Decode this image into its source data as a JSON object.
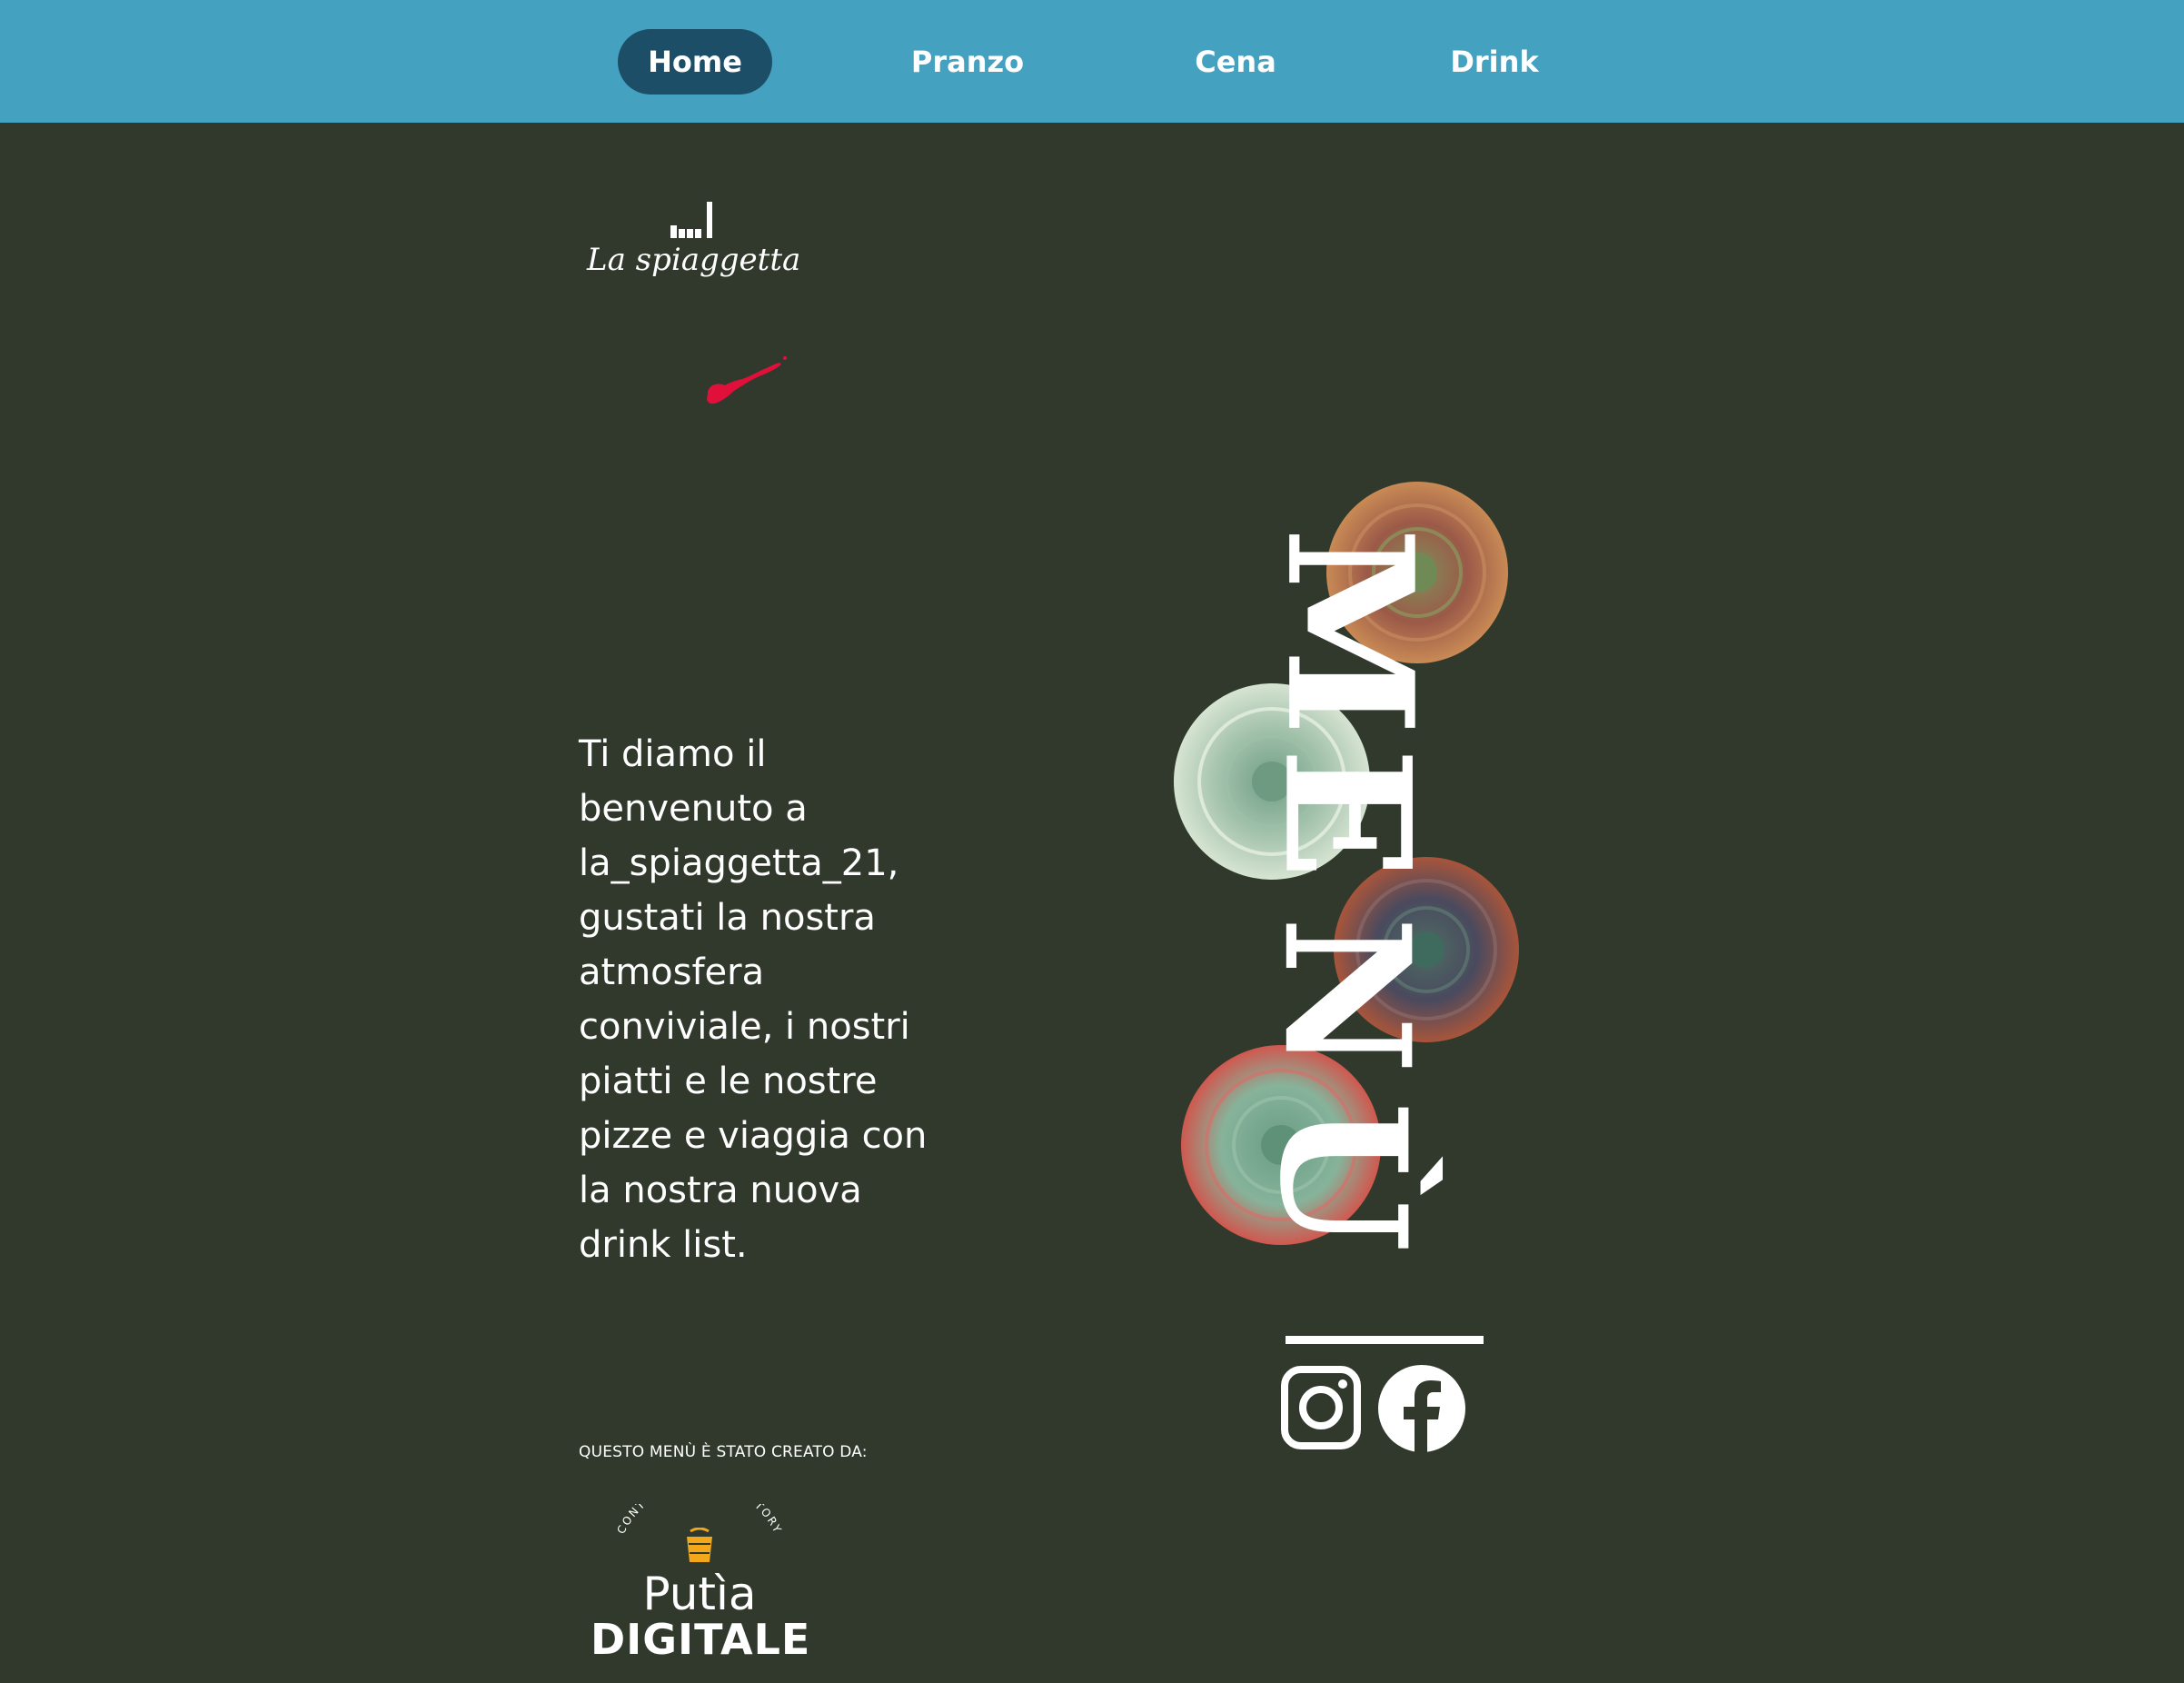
{
  "colors": {
    "background": "#30392c",
    "nav_bar": "#44a1c0",
    "nav_active": "#1c4e67",
    "text": "#ffffff",
    "accent_blob": "#e0103a",
    "brand_icon": "#f2a81d"
  },
  "nav": {
    "items": [
      {
        "label": "Home",
        "active": true
      },
      {
        "label": "Pranzo",
        "active": false
      },
      {
        "label": "Cena",
        "active": false
      },
      {
        "label": "Drink",
        "active": false
      }
    ]
  },
  "logo": {
    "text": "La spiaggetta"
  },
  "welcome": {
    "text": "Ti diamo il benvenuto a la_spiaggetta_21, gustati la nostra atmosfera conviviale, i nostri piatti e le nostre pizze e viaggia con la nostra nuova drink list."
  },
  "menu_art": {
    "letters": [
      "M",
      "E",
      "N",
      "Ù"
    ],
    "decoration": "succulent-flowers"
  },
  "social": {
    "icons": [
      "instagram-icon",
      "facebook-icon"
    ]
  },
  "credit": {
    "label": "QUESTO MENÙ È STATO CREATO DA:",
    "brand_arc": "CONTENT DESIGN FACTORY",
    "brand_name": "Putìa",
    "brand_sub": "DIGITALE"
  }
}
